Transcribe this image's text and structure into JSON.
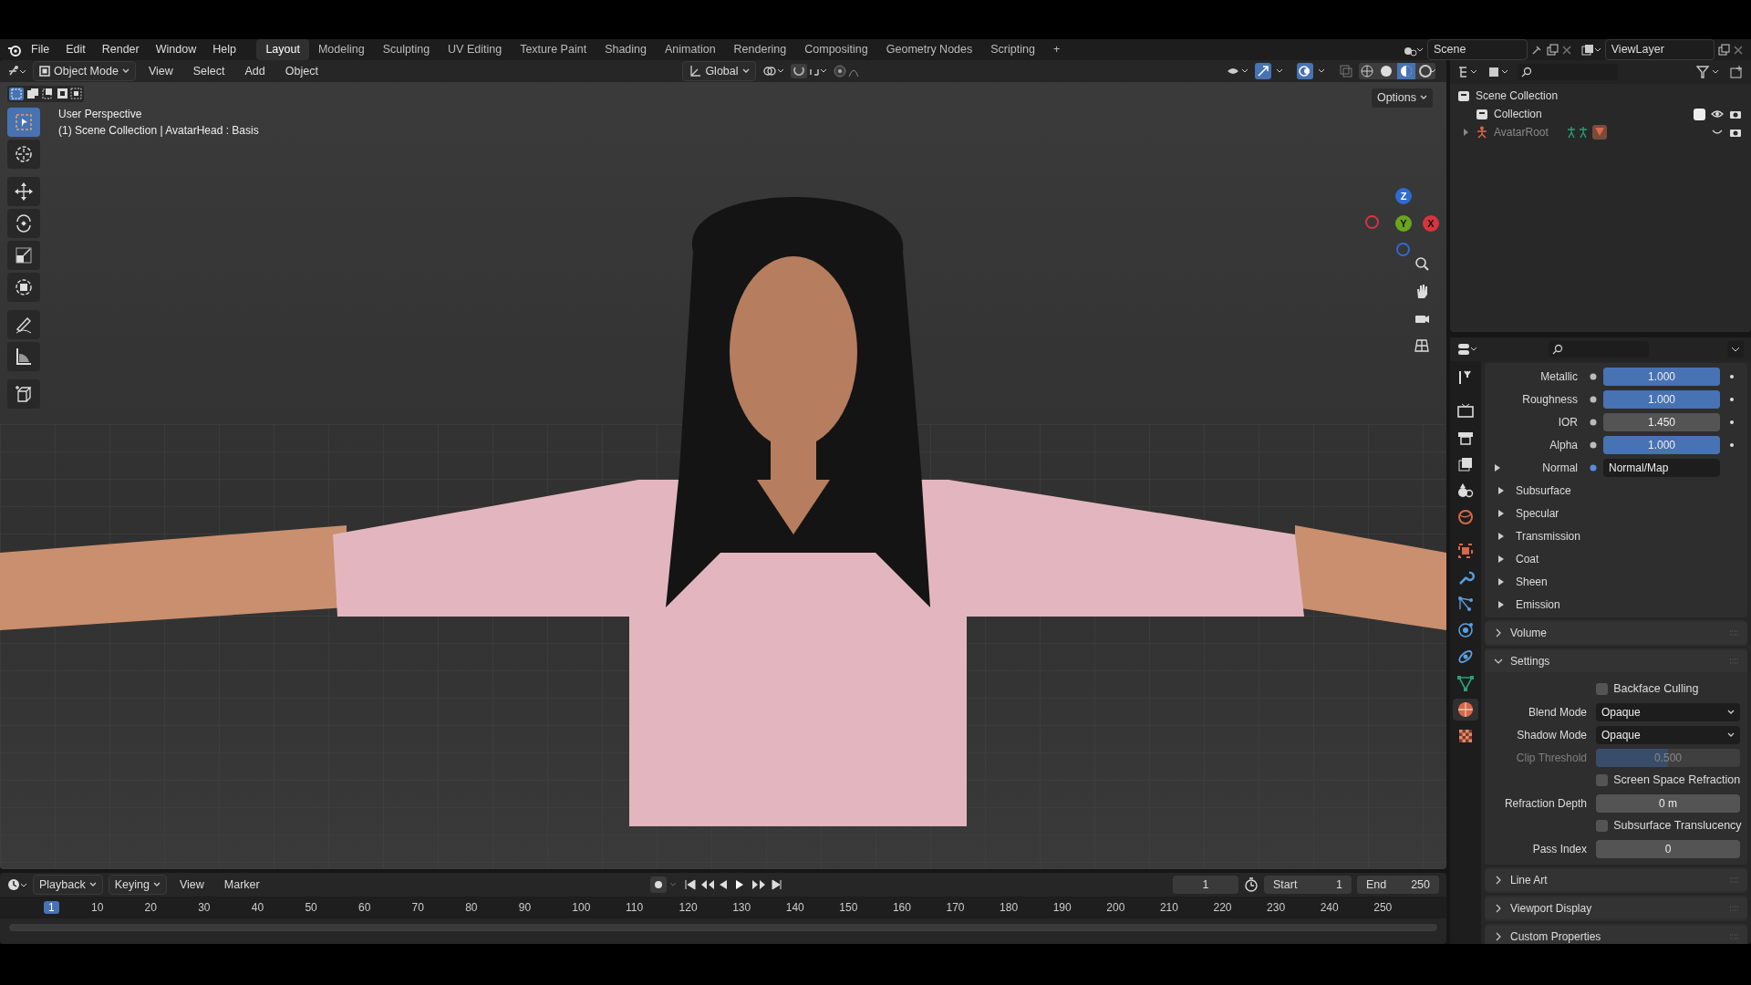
{
  "menu_bar": {
    "menus": [
      "File",
      "Edit",
      "Render",
      "Window",
      "Help"
    ],
    "workspaces": [
      {
        "label": "Layout",
        "selected": true
      },
      {
        "label": "Modeling",
        "selected": false
      },
      {
        "label": "Sculpting",
        "selected": false
      },
      {
        "label": "UV Editing",
        "selected": false
      },
      {
        "label": "Texture Paint",
        "selected": false
      },
      {
        "label": "Shading",
        "selected": false
      },
      {
        "label": "Animation",
        "selected": false
      },
      {
        "label": "Rendering",
        "selected": false
      },
      {
        "label": "Compositing",
        "selected": false
      },
      {
        "label": "Geometry Nodes",
        "selected": false
      },
      {
        "label": "Scripting",
        "selected": false
      }
    ],
    "add_tab": "+",
    "scene": "Scene",
    "view_layer": "ViewLayer"
  },
  "viewport_header": {
    "mode": "Object Mode",
    "menus": [
      "View",
      "Select",
      "Add",
      "Object"
    ],
    "orientation": "Global",
    "options": "Options"
  },
  "viewport": {
    "overlay_lines": [
      "User Perspective",
      "(1) Scene Collection | AvatarHead : Basis"
    ],
    "tools": [
      {
        "kind": "select",
        "selected": true
      },
      {
        "kind": "cursor",
        "selected": false
      },
      {
        "kind": "move",
        "selected": false
      },
      {
        "kind": "rotate",
        "selected": false
      },
      {
        "kind": "scale",
        "selected": false
      },
      {
        "kind": "transform",
        "selected": false
      },
      {
        "kind": "annotate",
        "selected": false
      },
      {
        "kind": "measure",
        "selected": false
      },
      {
        "kind": "cube",
        "selected": false
      }
    ],
    "gizmo_axes": [
      "Z",
      "Y",
      "X"
    ]
  },
  "outliner": {
    "items": [
      {
        "label": "Scene Collection",
        "kind": "scene"
      },
      {
        "label": "Collection",
        "kind": "collection",
        "checked": true
      },
      {
        "label": "AvatarRoot",
        "kind": "armature",
        "expanded": false
      }
    ]
  },
  "properties": {
    "tabs": [
      {
        "kind": "tool",
        "selected": false
      },
      {
        "kind": "render",
        "selected": false
      },
      {
        "kind": "output",
        "selected": false
      },
      {
        "kind": "view",
        "selected": false
      },
      {
        "kind": "scene",
        "selected": false
      },
      {
        "kind": "world",
        "selected": false
      },
      {
        "kind": "object",
        "selected": false
      },
      {
        "kind": "modifier",
        "selected": false
      },
      {
        "kind": "particles",
        "selected": false
      },
      {
        "kind": "physics",
        "selected": false
      },
      {
        "kind": "constraint",
        "selected": false
      },
      {
        "kind": "data",
        "selected": false
      },
      {
        "kind": "material",
        "selected": true
      },
      {
        "kind": "texture",
        "selected": false
      }
    ],
    "inputs": [
      {
        "kind": "slider",
        "label": "Metallic",
        "value": "1.000",
        "level": 1
      },
      {
        "kind": "slider",
        "label": "Roughness",
        "value": "1.000",
        "level": 1
      },
      {
        "kind": "number",
        "label": "IOR",
        "value": "1.450"
      },
      {
        "kind": "slider",
        "label": "Alpha",
        "value": "1.000",
        "level": 1
      },
      {
        "kind": "link",
        "label": "Normal",
        "value": "Normal/Map"
      }
    ],
    "subpanels": [
      "Subsurface",
      "Specular",
      "Transmission",
      "Coat",
      "Sheen",
      "Emission"
    ],
    "panels": [
      {
        "title": "Volume",
        "expanded": false
      },
      {
        "title": "Settings",
        "expanded": true,
        "rows": [
          {
            "kind": "checkbox",
            "label": "Backface Culling",
            "checked": false,
            "disabled": false
          },
          {
            "kind": "dropdown",
            "label": "Blend Mode",
            "value": "Opaque",
            "disabled": false
          },
          {
            "kind": "dropdown",
            "label": "Shadow Mode",
            "value": "Opaque",
            "disabled": false
          },
          {
            "kind": "slider",
            "label": "Clip Threshold",
            "value": "0.500",
            "level": 0.5,
            "disabled": true
          },
          {
            "kind": "checkbox",
            "label": "Screen Space Refraction",
            "checked": false,
            "disabled": false
          },
          {
            "kind": "number",
            "label": "Refraction Depth",
            "value": "0 m",
            "disabled": false
          },
          {
            "kind": "checkbox",
            "label": "Subsurface Translucency",
            "checked": false,
            "disabled": false
          },
          {
            "kind": "number",
            "label": "Pass Index",
            "value": "0",
            "disabled": false
          }
        ]
      },
      {
        "title": "Line Art",
        "expanded": false
      },
      {
        "title": "Viewport Display",
        "expanded": false
      },
      {
        "title": "Custom Properties",
        "expanded": false
      }
    ]
  },
  "timeline": {
    "menus": [
      "Playback",
      "Keying",
      "View",
      "Marker"
    ],
    "current_frame": "1",
    "start_label": "Start",
    "start": "1",
    "end_label": "End",
    "end": "250",
    "ruler": [
      {
        "label": "1",
        "selected": true
      },
      {
        "label": "10",
        "selected": false
      },
      {
        "label": "20",
        "selected": false
      },
      {
        "label": "30",
        "selected": false
      },
      {
        "label": "40",
        "selected": false
      },
      {
        "label": "50",
        "selected": false
      },
      {
        "label": "60",
        "selected": false
      },
      {
        "label": "70",
        "selected": false
      },
      {
        "label": "80",
        "selected": false
      },
      {
        "label": "90",
        "selected": false
      },
      {
        "label": "100",
        "selected": false
      },
      {
        "label": "110",
        "selected": false
      },
      {
        "label": "120",
        "selected": false
      },
      {
        "label": "130",
        "selected": false
      },
      {
        "label": "140",
        "selected": false
      },
      {
        "label": "150",
        "selected": false
      },
      {
        "label": "160",
        "selected": false
      },
      {
        "label": "170",
        "selected": false
      },
      {
        "label": "180",
        "selected": false
      },
      {
        "label": "190",
        "selected": false
      },
      {
        "label": "200",
        "selected": false
      },
      {
        "label": "210",
        "selected": false
      },
      {
        "label": "220",
        "selected": false
      },
      {
        "label": "230",
        "selected": false
      },
      {
        "label": "240",
        "selected": false
      },
      {
        "label": "250",
        "selected": false
      }
    ]
  }
}
